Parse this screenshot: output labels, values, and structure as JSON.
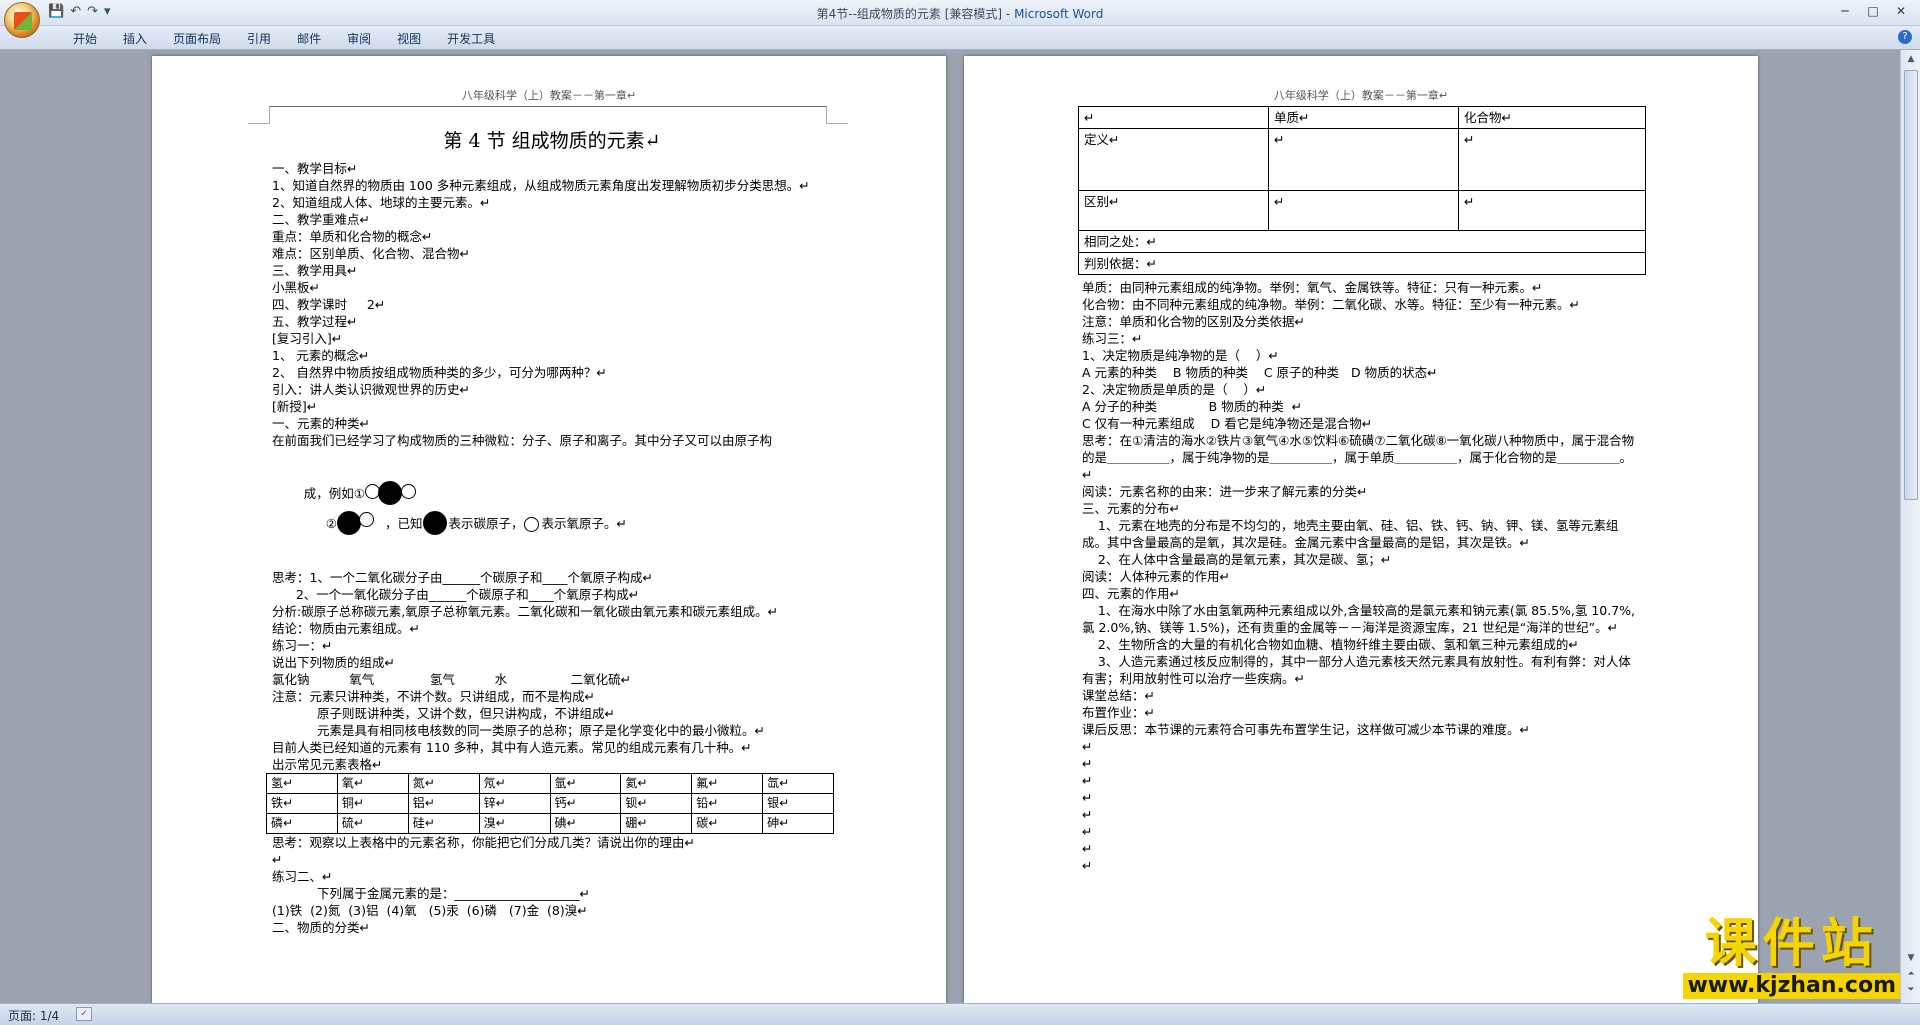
{
  "window": {
    "title": "第4节--组成物质的元素 [兼容模式] - ",
    "app_name": "Microsoft Word"
  },
  "ribbon": {
    "tabs": [
      "开始",
      "插入",
      "页面布局",
      "引用",
      "邮件",
      "审阅",
      "视图",
      "开发工具"
    ]
  },
  "status": {
    "pages": "页面: 1/4"
  },
  "watermark": {
    "brand": "课件站",
    "url": "www.kjzhan.com"
  },
  "page1": {
    "header": "八年级科学（上）教案－－第一章↵",
    "title": "第 4 节    组成物质的元素↵",
    "lines_a": [
      "一、教学目标↵",
      "1、知道自然界的物质由 100 多种元素组成，从组成物质元素角度出发理解物质初步分类思想。↵",
      "2、知道组成人体、地球的主要元素。↵",
      "二、教学重难点↵",
      "重点：单质和化合物的概念↵",
      "难点：区别单质、化合物、混合物↵",
      "三、教学用具↵",
      "小黑板↵",
      "四、教学课时     2↵",
      "五、教学过程↵",
      "[复习引入]↵",
      "1、 元素的概念↵",
      "2、 自然界中物质按组成物质种类的多少，可分为哪两种？↵",
      "引入：讲人类认识微观世界的历史↵",
      "[新授]↵",
      "一、元素的种类↵",
      "在前面我们已经学习了构成物质的三种微粒：分子、原子和离子。其中分子又可以由原子构"
    ],
    "molecule_line": {
      "prefix": "成，例如①",
      "mid": "②",
      "known": "，已知",
      "carbon": "表示碳原子，",
      "oxygen": "表示氧原子。↵"
    },
    "lines_b": [
      "思考：1、一个二氧化碳分子由______个碳原子和____个氧原子构成↵",
      "      2、一个一氧化碳分子由______个碳原子和____个氧原子构成↵",
      "分析:碳原子总称碳元素,氧原子总称氧元素。二氧化碳和一氧化碳由氧元素和碳元素组成。↵",
      "结论：物质由元素组成。↵",
      "练习一：↵",
      "说出下列物质的组成↵",
      "氯化钠          氧气              氢气          水                二氧化硫↵",
      "注意：元素只讲种类，不讲个数。只讲组成，而不是构成↵",
      "原子则既讲种类，又讲个数，但只讲构成，不讲组成↵",
      "元素是具有相同核电核数的同一类原子的总称；原子是化学变化中的最小微粒。↵",
      "目前人类已经知道的元素有 110 多种，其中有人造元素。常见的组成元素有几十种。↵",
      "出示常见元素表格↵"
    ],
    "element_table": [
      [
        "氢↵",
        "氧↵",
        "氮↵",
        "氖↵",
        "氩↵",
        "氦↵",
        "氟↵",
        "氙↵"
      ],
      [
        "铁↵",
        "铜↵",
        "铝↵",
        "锌↵",
        "钙↵",
        "钡↵",
        "铅↵",
        "银↵"
      ],
      [
        "磷↵",
        "硫↵",
        "硅↵",
        "溴↵",
        "碘↵",
        "硼↵",
        "碳↵",
        "砷↵"
      ]
    ],
    "lines_c": [
      "思考：观察以上表格中的元素名称，你能把它们分成几类？请说出你的理由↵",
      "↵",
      "练习二、↵",
      "下列属于金属元素的是：____________________↵",
      "(1)铁  (2)氮  (3)铝  (4)氧   (5)汞  (6)磷   (7)金  (8)溴↵",
      "二、物质的分类↵"
    ]
  },
  "page2": {
    "header": "八年级科学（上）教案－－第一章↵",
    "compare_table": {
      "head": [
        "↵",
        "单质↵",
        "化合物↵"
      ],
      "row1": [
        "定义↵",
        "↵",
        "↵"
      ],
      "row2": [
        "区别↵",
        "↵",
        "↵"
      ],
      "same": "相同之处：↵",
      "judge": "判别依据：↵"
    },
    "lines": [
      "单质：由同种元素组成的纯净物。举例：氧气、金属铁等。特征：只有一种元素。↵",
      "化合物：由不同种元素组成的纯净物。举例：二氧化碳、水等。特征：至少有一种元素。↵",
      "注意：单质和化合物的区别及分类依据↵",
      "练习三：↵",
      "1、决定物质是纯净物的是（    ）↵",
      "A 元素的种类    B 物质的种类    C 原子的种类   D 物质的状态↵",
      "2、决定物质是单质的是（    ）↵",
      "A 分子的种类             B 物质的种类  ↵",
      "C 仅有一种元素组成    D 看它是纯净物还是混合物↵",
      "思考：在①清洁的海水②铁片③氧气④水⑤饮料⑥硫磺⑦二氧化碳⑧一氧化碳八种物质中，属于混合物的是＿＿＿＿＿，属于纯净物的是＿＿＿＿＿，属于单质＿＿＿＿＿，属于化合物的是＿＿＿＿＿。↵",
      "阅读：元素名称的由来：进一步来了解元素的分类↵",
      "三、元素的分布↵",
      "    1、元素在地壳的分布是不均匀的，地壳主要由氧、硅、铝、铁、钙、钠、钾、镁、氢等元素组成。其中含量最高的是氧，其次是硅。金属元素中含量最高的是铝，其次是铁。↵",
      "    2、在人体中含量最高的是氧元素，其次是碳、氢；↵",
      "阅读：人体种元素的作用↵",
      "四、元素的作用↵",
      "    1、在海水中除了水由氢氧两种元素组成以外,含量较高的是氯元素和钠元素(氯 85.5%,氢 10.7%,氯 2.0%,钠、镁等 1.5%)，还有贵重的金属等－－海洋是资源宝库，21 世纪是“海洋的世纪”。↵",
      "    2、生物所含的大量的有机化合物如血糖、植物纤维主要由碳、氢和氧三种元素组成的↵",
      "    3、人造元素通过核反应制得的，其中一部分人造元素核天然元素具有放射性。有利有弊：对人体有害；利用放射性可以治疗一些疾病。↵",
      "课堂总结：↵",
      "布置作业：↵",
      "课后反思：本节课的元素符合可事先布置学生记，这样做可减少本节课的难度。↵",
      "↵",
      "↵",
      "↵",
      "↵",
      "↵",
      "↵",
      "↵",
      "↵"
    ]
  }
}
